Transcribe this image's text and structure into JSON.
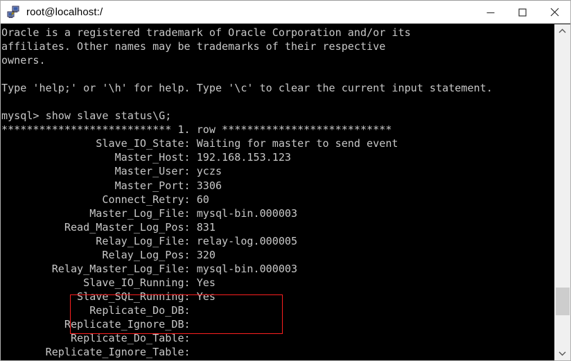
{
  "window": {
    "title": "root@localhost:/",
    "icon": "putty-terminal-icon",
    "controls": {
      "minimize_label": "Minimize",
      "maximize_label": "Maximize",
      "close_label": "Close"
    }
  },
  "colors": {
    "terminal_background": "#000000",
    "terminal_foreground": "#c8c8c8",
    "annotation": "#ff2020",
    "titlebar_background": "#ffffff",
    "scrollbar_track": "#f0f0f0",
    "scrollbar_thumb": "#cdcdcd"
  },
  "terminal": {
    "lines": [
      "Oracle is a registered trademark of Oracle Corporation and/or its",
      "affiliates. Other names may be trademarks of their respective",
      "owners.",
      "",
      "Type 'help;' or '\\h' for help. Type '\\c' to clear the current input statement.",
      "",
      "mysql> show slave status\\G;",
      "*************************** 1. row ***************************",
      "               Slave_IO_State: Waiting for master to send event",
      "                  Master_Host: 192.168.153.123",
      "                  Master_User: yczs",
      "                  Master_Port: 3306",
      "                Connect_Retry: 60",
      "              Master_Log_File: mysql-bin.000003",
      "          Read_Master_Log_Pos: 831",
      "               Relay_Log_File: relay-log.000005",
      "                Relay_Log_Pos: 320",
      "        Relay_Master_Log_File: mysql-bin.000003",
      "             Slave_IO_Running: Yes",
      "            Slave_SQL_Running: Yes",
      "              Replicate_Do_DB:",
      "          Replicate_Ignore_DB:",
      "           Replicate_Do_Table:",
      "       Replicate_Ignore_Table:"
    ],
    "prompt": "mysql>",
    "command": "show slave status\\G;",
    "row_header": "*************************** 1. row ***************************",
    "fields": [
      {
        "name": "Slave_IO_State",
        "value": "Waiting for master to send event"
      },
      {
        "name": "Master_Host",
        "value": "192.168.153.123"
      },
      {
        "name": "Master_User",
        "value": "yczs"
      },
      {
        "name": "Master_Port",
        "value": "3306"
      },
      {
        "name": "Connect_Retry",
        "value": "60"
      },
      {
        "name": "Master_Log_File",
        "value": "mysql-bin.000003"
      },
      {
        "name": "Read_Master_Log_Pos",
        "value": "831"
      },
      {
        "name": "Relay_Log_File",
        "value": "relay-log.000005"
      },
      {
        "name": "Relay_Log_Pos",
        "value": "320"
      },
      {
        "name": "Relay_Master_Log_File",
        "value": "mysql-bin.000003"
      },
      {
        "name": "Slave_IO_Running",
        "value": "Yes"
      },
      {
        "name": "Slave_SQL_Running",
        "value": "Yes"
      },
      {
        "name": "Replicate_Do_DB",
        "value": ""
      },
      {
        "name": "Replicate_Ignore_DB",
        "value": ""
      },
      {
        "name": "Replicate_Do_Table",
        "value": ""
      },
      {
        "name": "Replicate_Ignore_Table",
        "value": ""
      }
    ]
  },
  "annotation": {
    "description": "red rectangle highlighting Slave_IO_Running and Slave_SQL_Running rows",
    "highlighted_fields": [
      "Slave_IO_Running: Yes",
      "Slave_SQL_Running: Yes"
    ]
  },
  "scrollbar": {
    "up_arrow": "chevron-up-icon",
    "down_arrow": "chevron-down-icon"
  }
}
